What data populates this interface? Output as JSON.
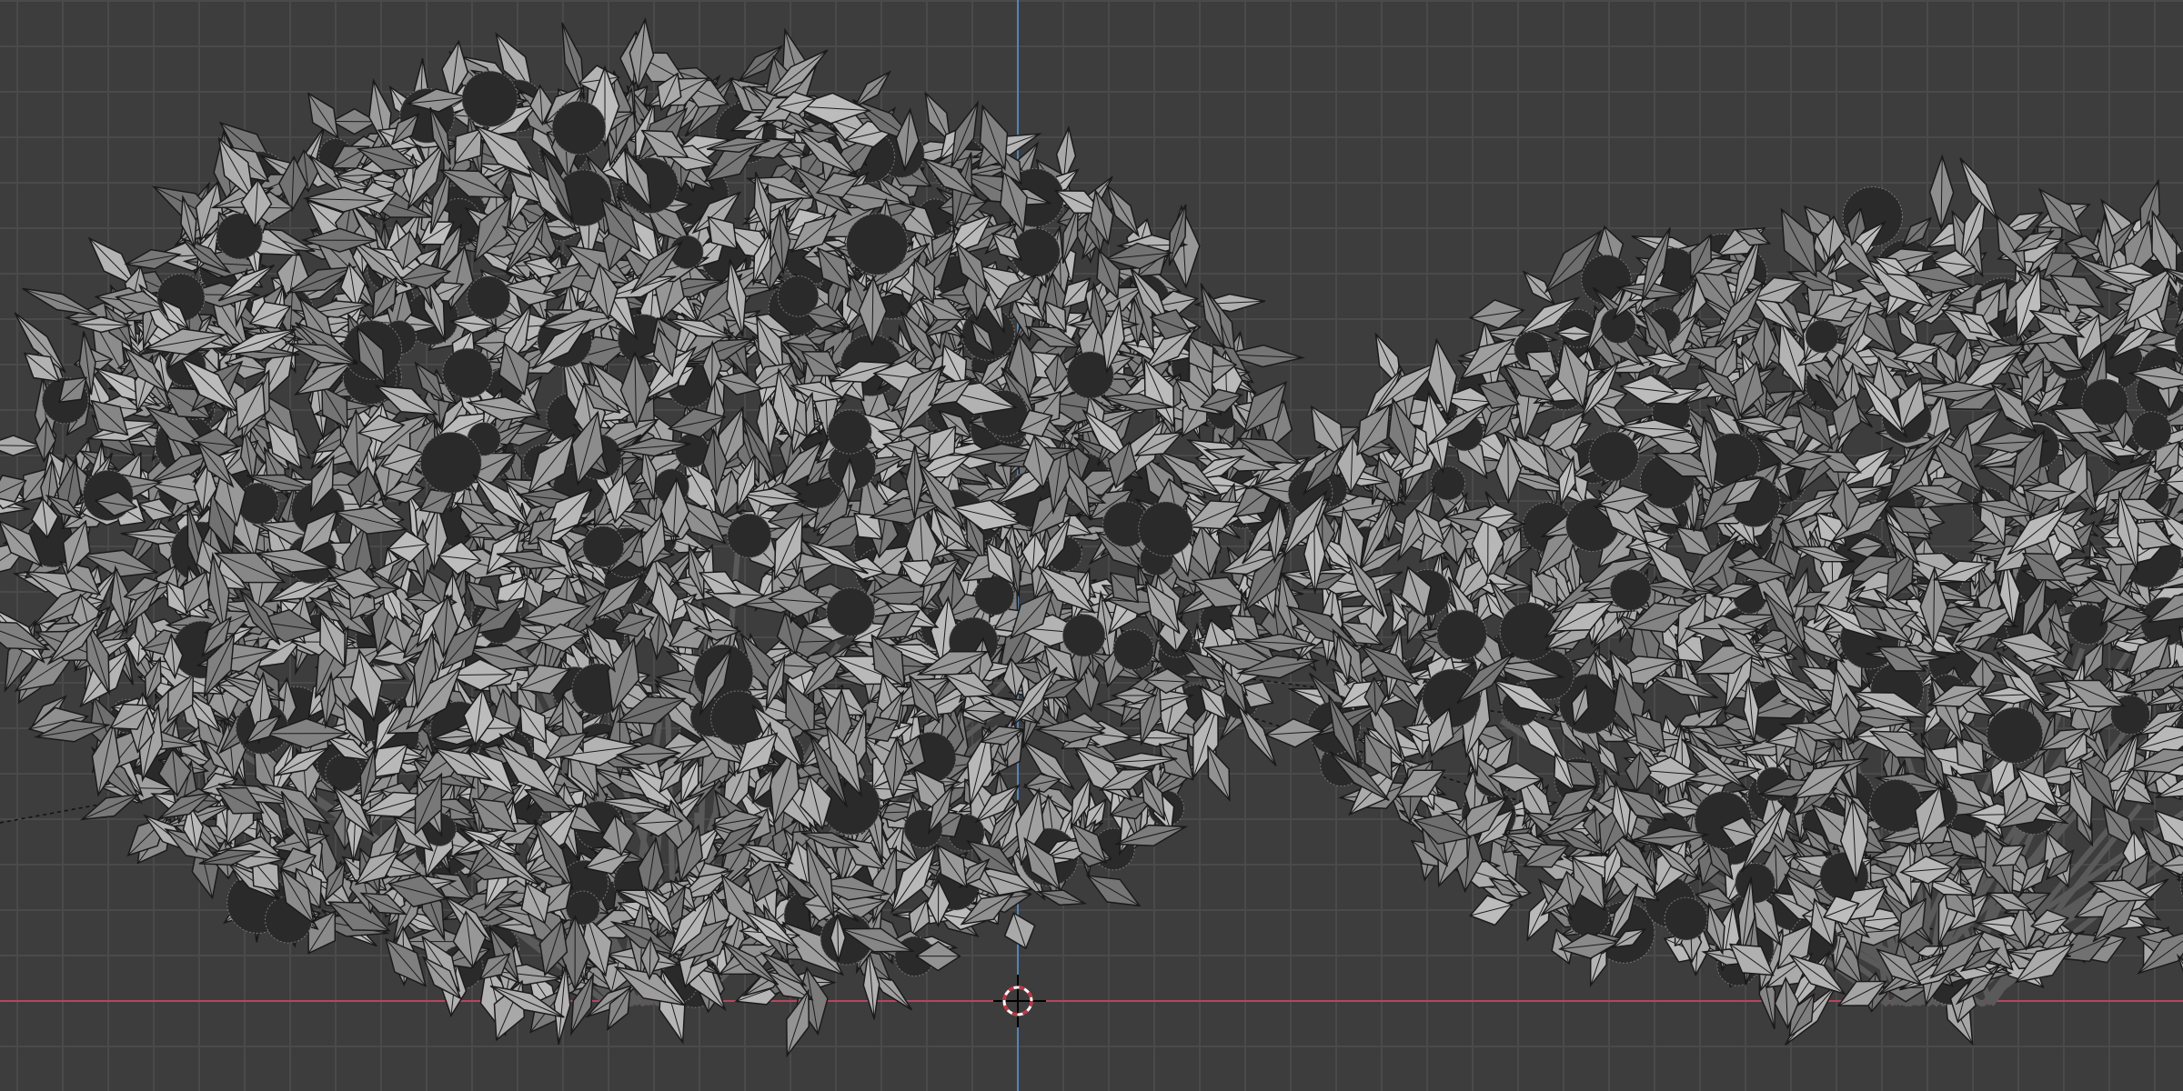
{
  "viewport": {
    "mode": "wireframe-overlay",
    "colors": {
      "background": "#3d3d3d",
      "grid": "#4a4a4a",
      "x_axis": "#b5475f",
      "z_axis": "#4f86c0",
      "mesh_face": "#8f8f8f",
      "mesh_edge": "#1a1a1a"
    },
    "objects": [
      {
        "name_icon": "bush-mesh-icon"
      },
      {
        "name_icon": "bush-mesh-icon"
      }
    ],
    "cursor_icon": "3d-cursor-icon"
  }
}
